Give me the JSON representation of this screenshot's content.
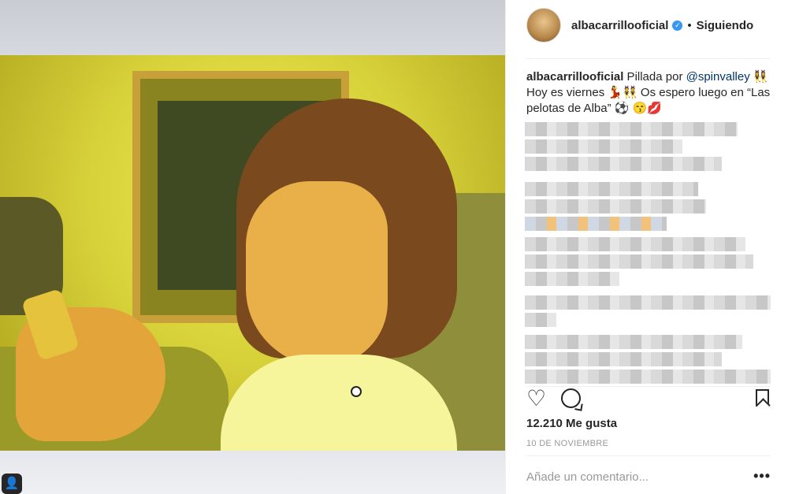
{
  "post": {
    "username": "albacarrillooficial",
    "follow_status": "Siguiendo",
    "separator": "•",
    "caption": {
      "username": "albacarrillooficial",
      "text_1": " Pillada por ",
      "mention": "@spinvalley",
      "text_2": " 👯‍♀️ Hoy es viernes 💃👯 Os espero luego en “Las pelotas de Alba” ⚽️ 😙💋"
    },
    "likes_label": "12.210 Me gusta",
    "date_label": "10 DE NOVIEMBRE",
    "comment_placeholder": "Añade un comentario...",
    "more_label": "•••"
  },
  "icons": {
    "verified": "verified-badge-icon",
    "like": "heart-icon",
    "comment": "comment-icon",
    "save": "bookmark-icon",
    "more": "more-options-icon",
    "user": "user-icon",
    "zoom": "zoom-cursor-icon"
  },
  "colors": {
    "verified_blue": "#3897f0",
    "mention_blue": "#003569",
    "muted_gray": "#999999",
    "text_dark": "#262626"
  }
}
